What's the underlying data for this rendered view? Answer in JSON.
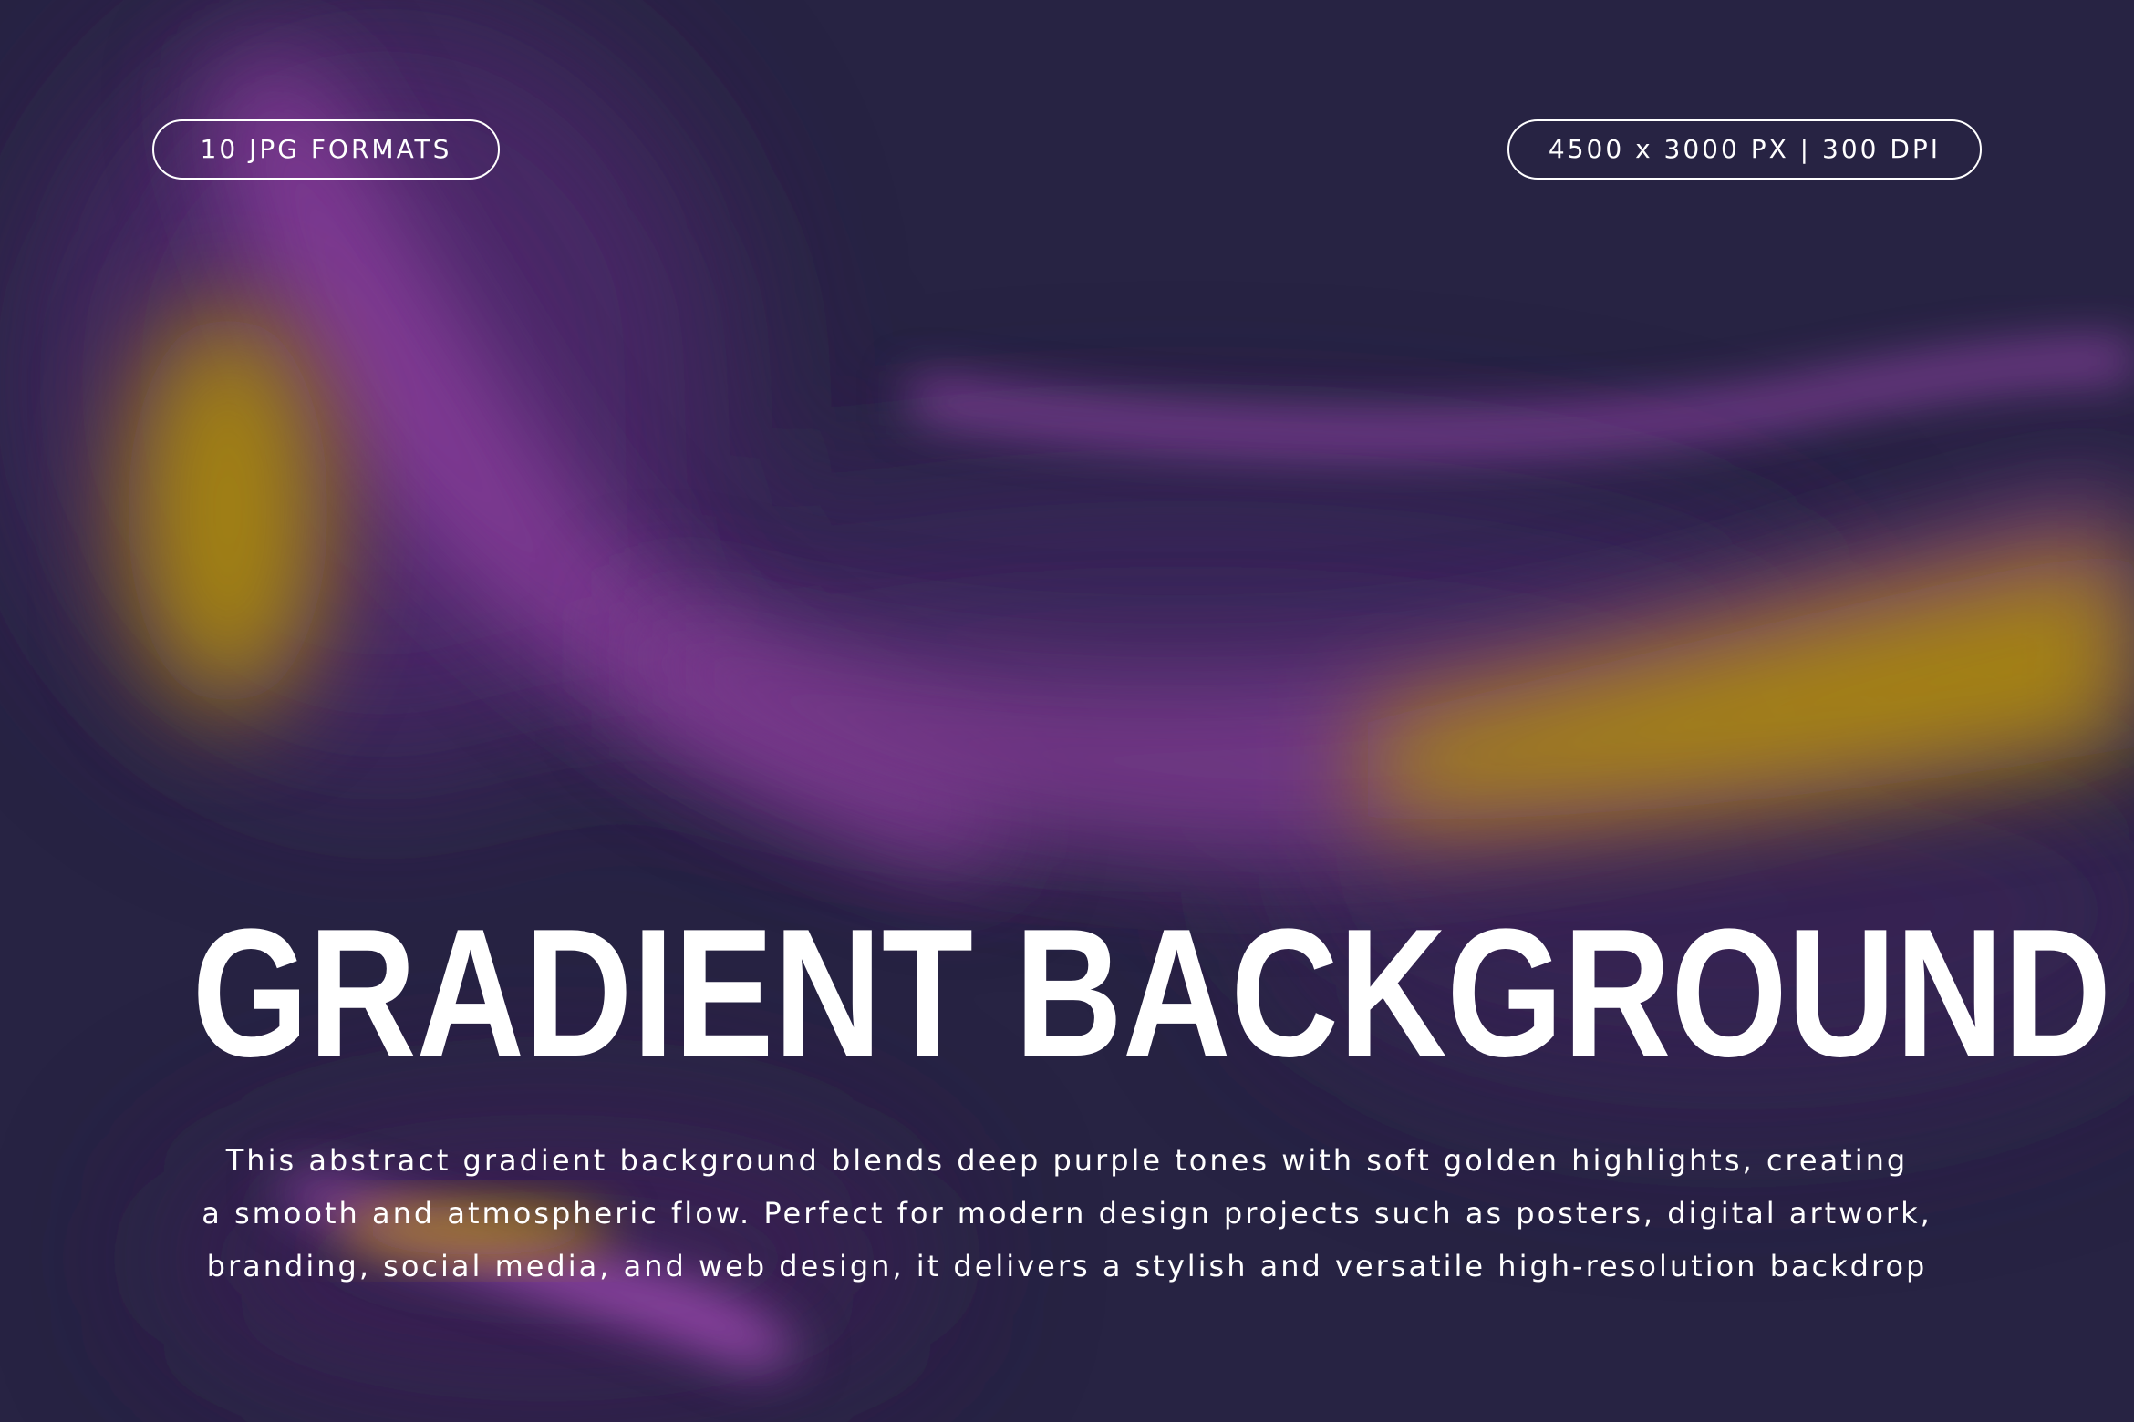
{
  "badges": {
    "left": "10 JPG FORMATS",
    "right": "4500 x 3000 PX | 300 DPI"
  },
  "heading": "GRADIENT BACKGROUND",
  "description": [
    "This abstract gradient background blends deep purple tones with soft golden highlights, creating",
    "a smooth and atmospheric flow. Perfect for modern design projects such as posters, digital artwork,",
    "branding, social media, and web design, it delivers a stylish and versatile high-resolution backdrop"
  ],
  "colors": {
    "base": "#272343",
    "purple": "#7a3a8c",
    "magenta": "#b04cc4",
    "gold": "#a8860e",
    "text": "#ffffff"
  }
}
